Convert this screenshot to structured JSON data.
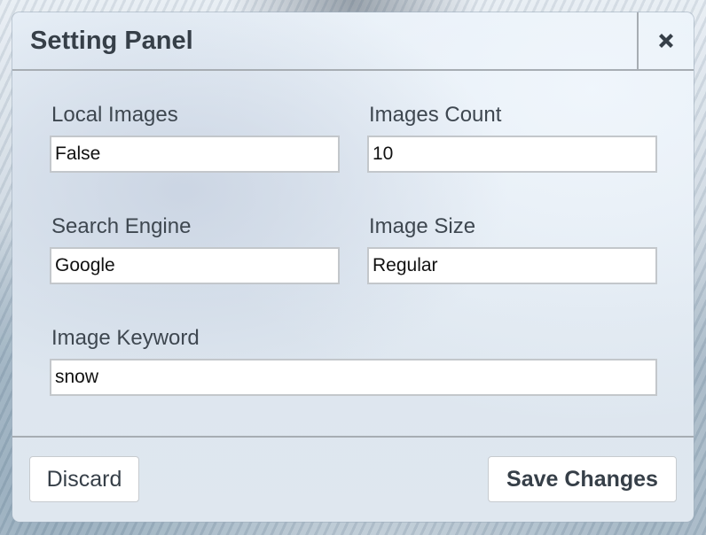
{
  "panel": {
    "title": "Setting Panel",
    "close_icon": "close-icon"
  },
  "fields": {
    "local_images": {
      "label": "Local Images",
      "value": "False"
    },
    "images_count": {
      "label": "Images Count",
      "value": "10"
    },
    "search_engine": {
      "label": "Search Engine",
      "value": "Google"
    },
    "image_size": {
      "label": "Image Size",
      "value": "Regular"
    },
    "image_keyword": {
      "label": "Image Keyword",
      "value": "snow"
    }
  },
  "footer": {
    "discard_label": "Discard",
    "save_label": "Save Changes"
  },
  "colors": {
    "title_text": "#363f48",
    "divider": "#a7adb3",
    "input_border": "#c3c7cb"
  }
}
